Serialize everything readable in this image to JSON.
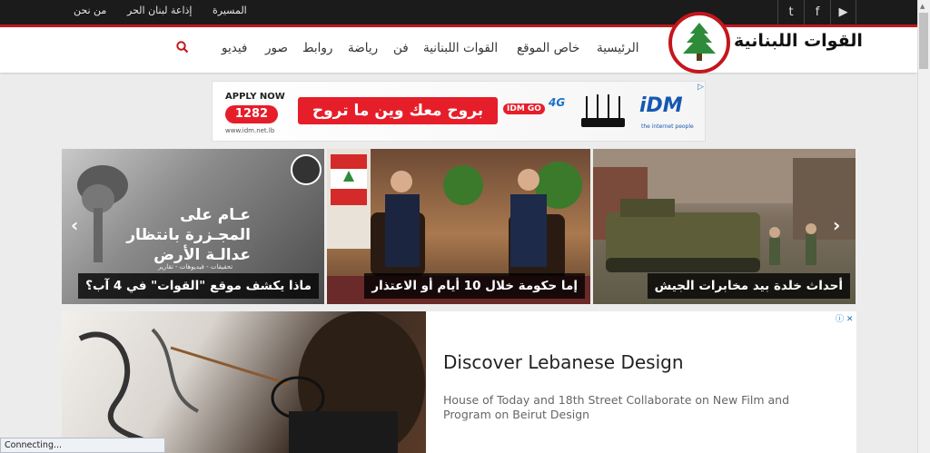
{
  "topbar": {
    "links": [
      "المسيرة",
      "إذاعة لبنان الحر",
      "من نحن"
    ],
    "social": {
      "twitter": "t",
      "facebook": "f",
      "youtube": "▶"
    }
  },
  "logo": {
    "text": "القوات اللبنانية"
  },
  "menu": {
    "items": [
      "الرئيسية",
      "خاص الموقع",
      "القوات اللبنانية",
      "فن",
      "رياضة",
      "روابط",
      "صور",
      "فيديو"
    ]
  },
  "ad_banner": {
    "apply": "APPLY NOW",
    "number": "1282",
    "url": "www.idm.net.lb",
    "slogan": "بروح معك وين ما تروح",
    "idmgo": "IDM GO",
    "network": "4G",
    "brand": "iDM",
    "tagline": "the internet people"
  },
  "slides": [
    {
      "caption": "ماذا يكشف موقع \"القوات\" في 4 آب؟",
      "overlay_title": "عـام على المجـزرة بانتظار عدالـة الأرض",
      "overlay_tags": "تحقيقات - فيديوهات - تقارير"
    },
    {
      "caption": "إما حكومة خلال 10 أيام أو الاعتذار"
    },
    {
      "caption": "أحداث خلدة بيد مخابرات الجيش"
    }
  ],
  "slider": {
    "prev_arrow": "‹",
    "next_arrow": "›"
  },
  "ad2": {
    "title": "Discover Lebanese Design",
    "body": "House of Today and 18th Street Collaborate on New Film and Program on Beirut Design",
    "badge": "ⓘ ✕"
  },
  "status": {
    "text": "Connecting..."
  },
  "colors": {
    "brand_red": "#c4161c",
    "topbar": "#1b1b1b"
  }
}
